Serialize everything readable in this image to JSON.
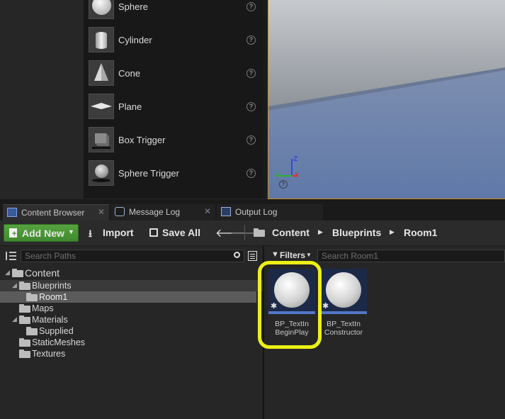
{
  "place_actors": {
    "items": [
      {
        "label": "Sphere",
        "icon": "sphere-icon"
      },
      {
        "label": "Cylinder",
        "icon": "cylinder-icon"
      },
      {
        "label": "Cone",
        "icon": "cone-icon"
      },
      {
        "label": "Plane",
        "icon": "plane-icon"
      },
      {
        "label": "Box Trigger",
        "icon": "box-trigger-icon"
      },
      {
        "label": "Sphere Trigger",
        "icon": "sphere-trigger-icon"
      }
    ],
    "help_glyph": "?"
  },
  "viewport": {
    "axis_labels": {
      "z": "Z",
      "y": "Y",
      "x": "X"
    }
  },
  "tabs": [
    {
      "label": "Content Browser",
      "icon": "content-browser-icon",
      "active": true
    },
    {
      "label": "Message Log",
      "icon": "message-log-icon",
      "active": false
    },
    {
      "label": "Output Log",
      "icon": "output-log-icon",
      "active": false
    }
  ],
  "toolbar": {
    "add_new_label": "Add New",
    "import_label": "Import",
    "save_all_label": "Save All",
    "breadcrumb": [
      "Content",
      "Blueprints",
      "Room1"
    ]
  },
  "tree": {
    "search_placeholder": "Search Paths",
    "items": [
      {
        "label": "Content",
        "level": 0,
        "expanded": true
      },
      {
        "label": "Blueprints",
        "level": 1,
        "expanded": true
      },
      {
        "label": "Room1",
        "level": 2,
        "selected": true
      },
      {
        "label": "Maps",
        "level": 1
      },
      {
        "label": "Materials",
        "level": 1,
        "expanded": true
      },
      {
        "label": "Supplied",
        "level": 2
      },
      {
        "label": "StaticMeshes",
        "level": 1
      },
      {
        "label": "Textures",
        "level": 1
      }
    ]
  },
  "assets": {
    "filters_label": "Filters",
    "search_placeholder": "Search Room1",
    "items": [
      {
        "name_line1": "BP_TextIn",
        "name_line2": "BeginPlay"
      },
      {
        "name_line1": "BP_TextIn",
        "name_line2": "Constructor"
      }
    ]
  },
  "colors": {
    "highlight": "#ecf015",
    "add_new_green": "#4a9a36",
    "asset_bar": "#5177c8",
    "viewport_border": "#c98f1d"
  }
}
